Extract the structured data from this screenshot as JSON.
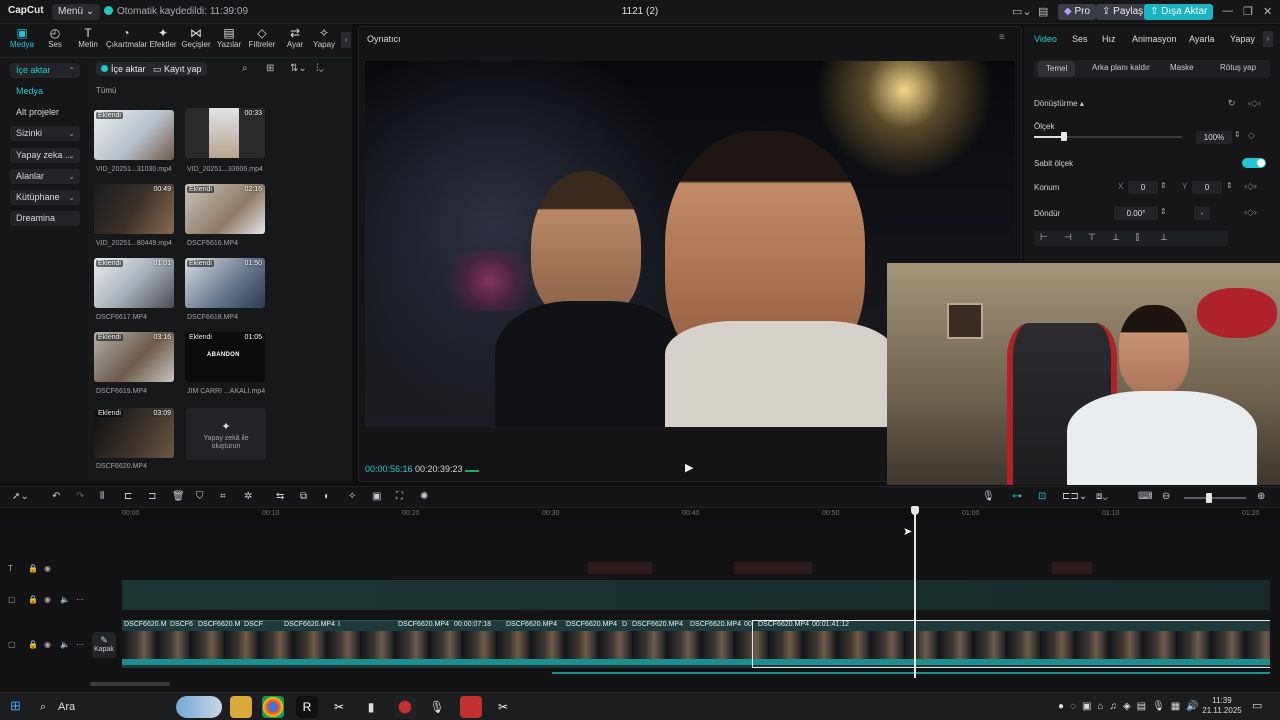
{
  "titlebar": {
    "logo": "CapCut",
    "menu": "Menü",
    "autosave": "Otomatik kaydedildi: 11:39:09",
    "project": "1121 (2)",
    "pro": "Pro",
    "share": "Paylaş",
    "export": "Dışa Aktar"
  },
  "left_tabs": [
    {
      "label": "Medya",
      "icon": "▣"
    },
    {
      "label": "Ses",
      "icon": "◴"
    },
    {
      "label": "Metin",
      "icon": "T"
    },
    {
      "label": "Çıkartmalar",
      "icon": "◔"
    },
    {
      "label": "Efektler",
      "icon": "✦"
    },
    {
      "label": "Geçişler",
      "icon": "⋈"
    },
    {
      "label": "Yazılar",
      "icon": "▤"
    },
    {
      "label": "Filtreler",
      "icon": "◇"
    },
    {
      "label": "Ayar",
      "icon": "⇄"
    },
    {
      "label": "Yapay",
      "icon": "✧"
    }
  ],
  "left_nav": [
    {
      "label": "İçe aktar"
    },
    {
      "label": "Medya"
    },
    {
      "label": "Alt projeler"
    },
    {
      "label": "Sizinki"
    },
    {
      "label": "Yapay zeka ..."
    },
    {
      "label": "Alanlar"
    },
    {
      "label": "Kütüphane"
    },
    {
      "label": "Dreamina"
    }
  ],
  "media": {
    "import": "İçe aktar",
    "record": "Kayıt yap",
    "all": "Tümü",
    "ai_create": "Yapay zekâ ile oluşturun",
    "added": "Eklendi",
    "items": [
      {
        "name": "VID_20251...31030.mp4",
        "duration": "",
        "added": true
      },
      {
        "name": "VID_20251...33606.mp4",
        "duration": "00:33",
        "added": false
      },
      {
        "name": "VID_20251...80449.mp4",
        "duration": "00:49",
        "added": false
      },
      {
        "name": "DSCF6616.MP4",
        "duration": "02:16",
        "added": true
      },
      {
        "name": "DSCF6617.MP4",
        "duration": "01:01",
        "added": true
      },
      {
        "name": "DSCF6618.MP4",
        "duration": "01:50",
        "added": true
      },
      {
        "name": "DSCF6619.MP4",
        "duration": "03:16",
        "added": true
      },
      {
        "name": "JİM CARRİ ...AKALI.mp4",
        "duration": "01:05",
        "added": true
      },
      {
        "name": "DSCF6620.MP4",
        "duration": "03:09",
        "added": true
      }
    ]
  },
  "player": {
    "title": "Oynatıcı",
    "current": "00:00:56:16",
    "total": "00:20:39:23"
  },
  "right": {
    "tabs": [
      "Video",
      "Ses",
      "Hız",
      "Animasyon",
      "Ayarla",
      "Yapay"
    ],
    "subtabs": [
      "Temel",
      "Arka planı kaldır",
      "Maske",
      "Rötuş yap"
    ],
    "transform": "Dönüştürme",
    "scale_label": "Ölçek",
    "scale_value": "100%",
    "uniform_scale": "Sabit ölçek",
    "position_label": "Konum",
    "pos_x_label": "X",
    "pos_x": "0",
    "pos_y_label": "Y",
    "pos_y": "0",
    "rotate_label": "Döndür",
    "rotate_value": "0.00°",
    "rotate_dash": "-"
  },
  "timeline": {
    "ruler": [
      "00:00",
      "00:10",
      "00:20",
      "00:30",
      "00:40",
      "00:50",
      "01:00",
      "01:10",
      "01:20"
    ],
    "cover": "Kapak",
    "clips": [
      "DSCF6620.M",
      "DSCF6",
      "DSCF6620.M",
      "DSCF",
      "DSCF6620.MP4",
      "I",
      "DSCF6620.MP4",
      "00:00:07:18",
      "DSCF6620.MP4",
      "DSCF6620.MP4",
      "D",
      "DSCF6620.MP4",
      "DSCF6620.MP4",
      "00",
      "DSCF6620.MP4",
      "00:01:41:12"
    ]
  },
  "taskbar": {
    "search": "Ara",
    "time": "11:39",
    "date": "21.11.2025"
  }
}
